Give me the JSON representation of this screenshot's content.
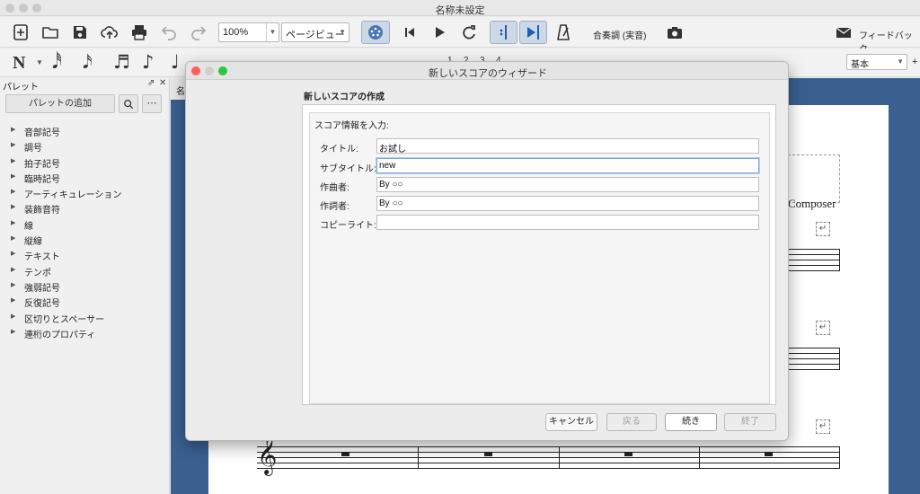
{
  "window": {
    "title": "名称未設定"
  },
  "toolbar": {
    "zoom_value": "100%",
    "view_mode": "ページビュー",
    "concert_pitch_label": "合奏調 (実音)",
    "feedback_label": "フィードバック",
    "workspace_value": "基本",
    "voice_numbers": [
      "1",
      "2",
      "3",
      "4"
    ],
    "add_label": "+"
  },
  "palette": {
    "title": "パレット",
    "add_button": "パレットの追加",
    "items": [
      "音部記号",
      "調号",
      "拍子記号",
      "臨時記号",
      "アーティキュレーション",
      "装飾音符",
      "線",
      "縦線",
      "テキスト",
      "テンポ",
      "強弱記号",
      "反復記号",
      "区切りとスペーサー",
      "連桁のプロパティ"
    ]
  },
  "score": {
    "tab_label": "名",
    "composer_text": "Composer"
  },
  "dialog": {
    "title": "新しいスコアのウィザード",
    "heading": "新しいスコアの作成",
    "section_label": "スコア情報を入力:",
    "fields": [
      {
        "label": "タイトル:",
        "value": "お試し"
      },
      {
        "label": "サブタイトル:",
        "value": "new"
      },
      {
        "label": "作曲者:",
        "value": "By ○○"
      },
      {
        "label": "作詞者:",
        "value": "By ○○"
      },
      {
        "label": "コピーライト:",
        "value": ""
      }
    ],
    "buttons": {
      "cancel": "キャンセル",
      "back": "戻る",
      "next": "続き",
      "finish": "終了"
    }
  }
}
